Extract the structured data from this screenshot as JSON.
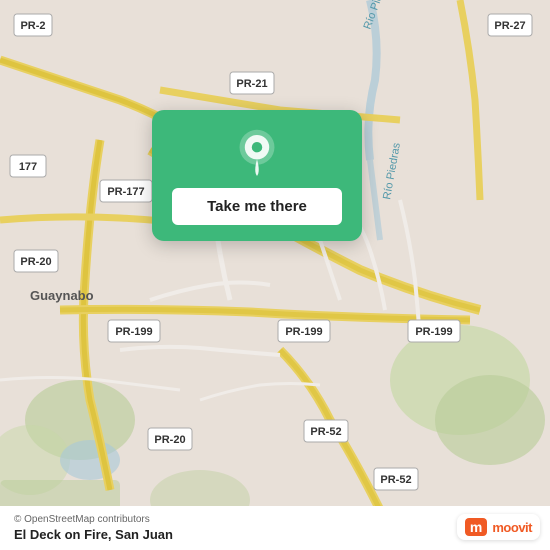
{
  "map": {
    "bg_color": "#e8e0d8",
    "osm_credit": "© OpenStreetMap contributors",
    "place_name": "El Deck on Fire, San Juan"
  },
  "card": {
    "button_label": "Take me there"
  },
  "moovit": {
    "m_letter": "m",
    "brand_text": "moovit"
  },
  "roads": [
    {
      "label": "PR-2"
    },
    {
      "label": "PR-20"
    },
    {
      "label": "PR-21"
    },
    {
      "label": "PR-27"
    },
    {
      "label": "PR-177"
    },
    {
      "label": "PR-199"
    },
    {
      "label": "PR-52"
    },
    {
      "label": "177"
    },
    {
      "label": "Guaynabo"
    },
    {
      "label": "Río Piedras"
    },
    {
      "label": "Río Pedras"
    }
  ],
  "icons": {
    "pin": "location-pin-icon",
    "osm_link": "osm-link-icon"
  }
}
